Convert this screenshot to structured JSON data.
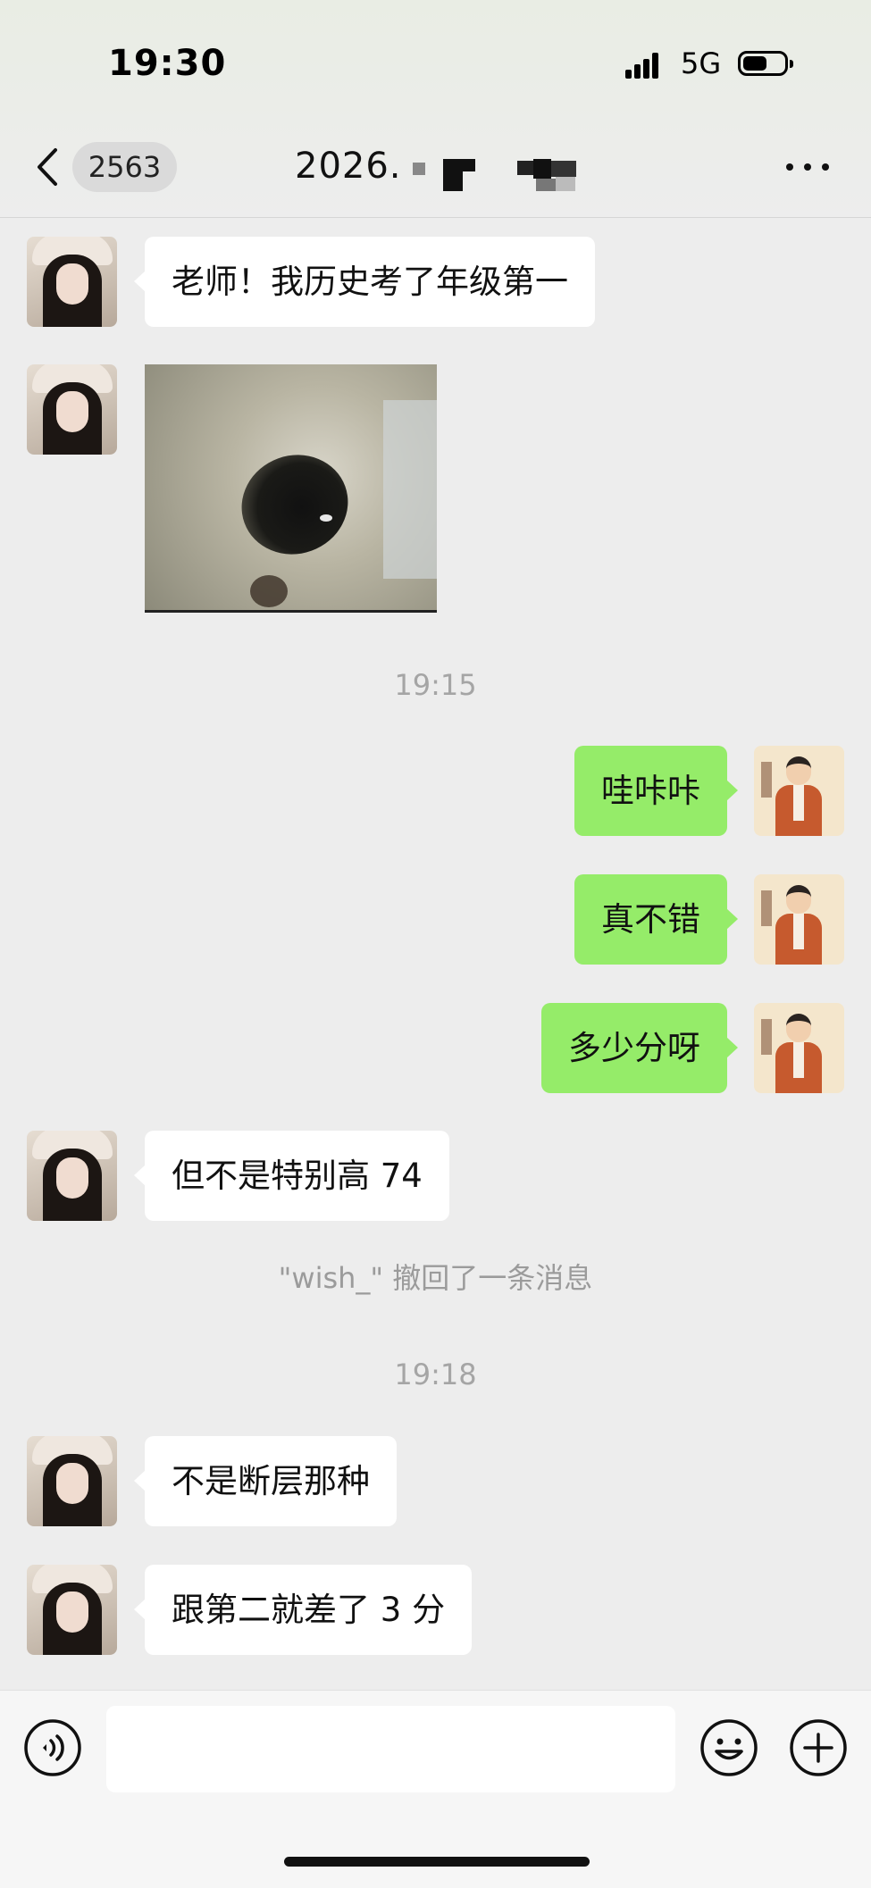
{
  "status_bar": {
    "time": "19:30",
    "network": "5G"
  },
  "nav": {
    "unread_count": "2563",
    "title": "2026."
  },
  "messages": [
    {
      "side": "left",
      "type": "text",
      "text": "老师！我历史考了年级第一"
    },
    {
      "side": "left",
      "type": "image",
      "image": "cat-eye-closeup"
    },
    {
      "type": "time",
      "text": "19:15"
    },
    {
      "side": "right",
      "type": "text",
      "text": "哇咔咔"
    },
    {
      "side": "right",
      "type": "text",
      "text": "真不错"
    },
    {
      "side": "right",
      "type": "text",
      "text": "多少分呀"
    },
    {
      "side": "left",
      "type": "text",
      "text": "但不是特别高 74"
    },
    {
      "type": "system",
      "text": "\"wish_\" 撤回了一条消息"
    },
    {
      "type": "time",
      "text": "19:18"
    },
    {
      "side": "left",
      "type": "text",
      "text": "不是断层那种"
    },
    {
      "side": "left",
      "type": "text",
      "text": "跟第二就差了 3 分"
    }
  ],
  "input_bar": {
    "voice_icon": "voice-icon",
    "emoji_icon": "emoji-icon",
    "plus_icon": "plus-icon",
    "value": ""
  },
  "colors": {
    "background": "#ededed",
    "self_bubble": "#95ec69",
    "other_bubble": "#ffffff"
  }
}
